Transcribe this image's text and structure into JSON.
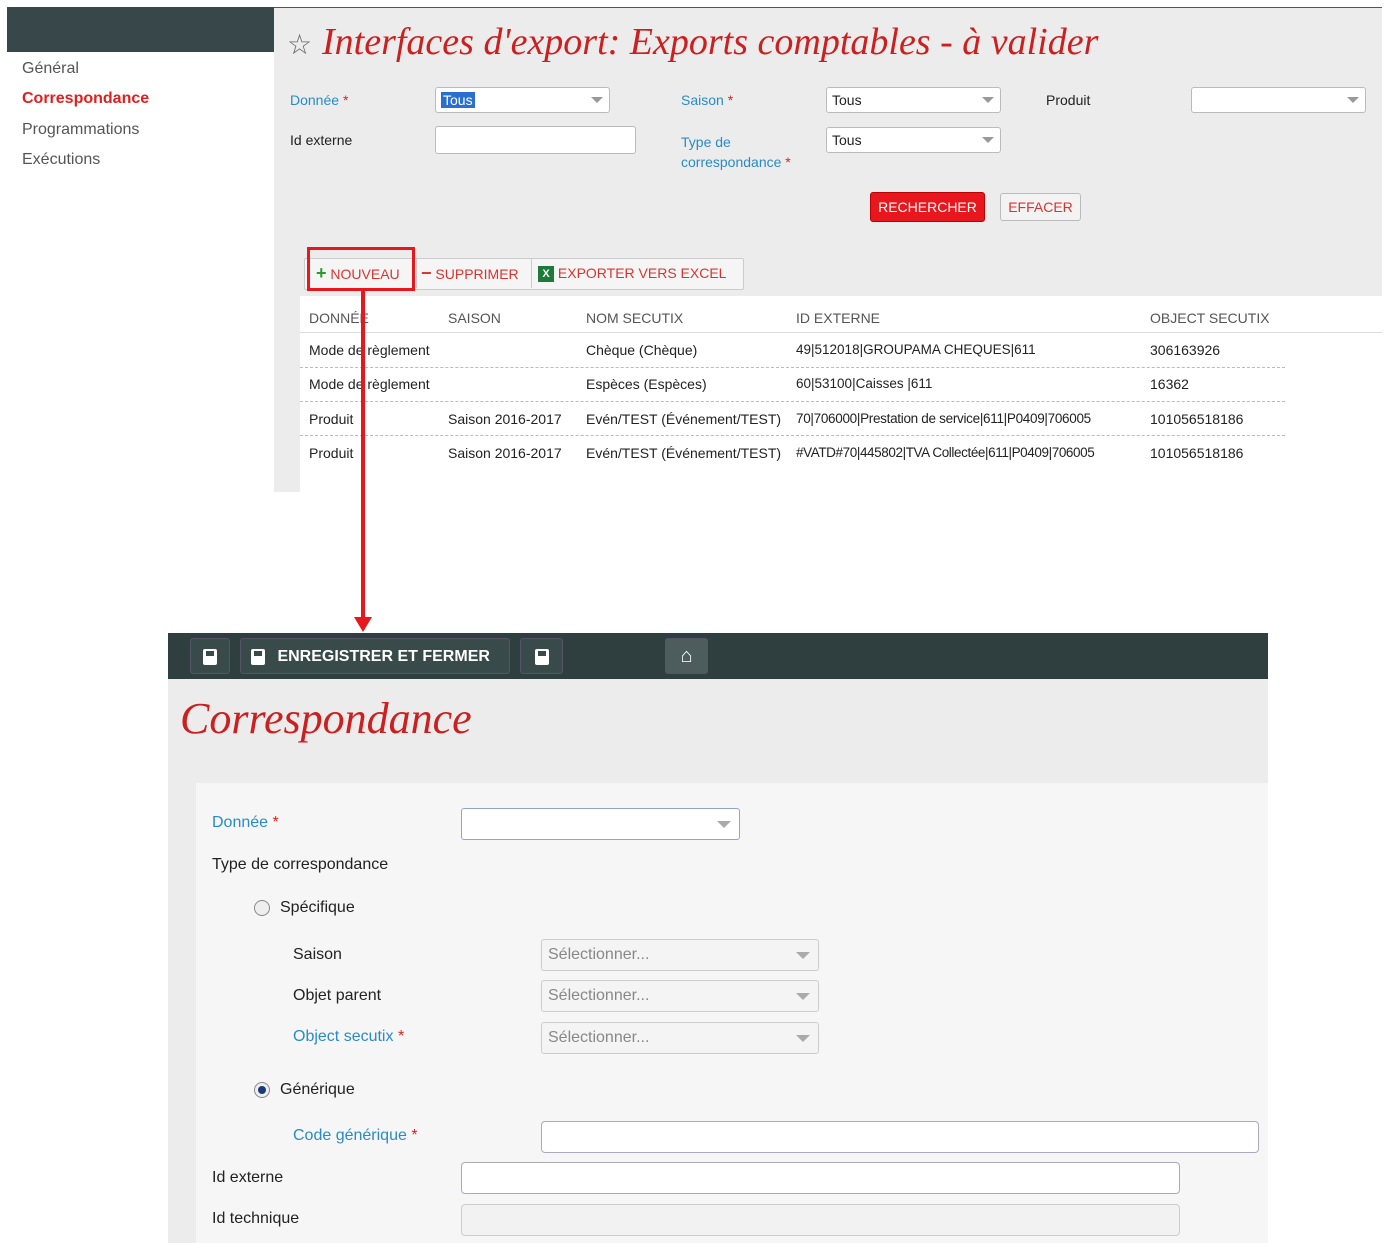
{
  "top": {
    "sidebar": [
      {
        "label": "Général",
        "active": false
      },
      {
        "label": "Correspondance",
        "active": true
      },
      {
        "label": "Programmations",
        "active": false
      },
      {
        "label": "Exécutions",
        "active": false
      }
    ],
    "title": "Interfaces d'export: Exports comptables - à valider",
    "filters": {
      "donnee_label": "Donnée",
      "donnee_value": "Tous",
      "saison_label": "Saison",
      "saison_value": "Tous",
      "produit_label": "Produit",
      "produit_value": "",
      "id_externe_label": "Id externe",
      "type_label_line1": "Type de",
      "type_label_line2": "correspondance",
      "type_value": "Tous",
      "required_mark": "*"
    },
    "buttons": {
      "search": "RECHERCHER",
      "clear": "EFFACER"
    },
    "toolbar": {
      "new": "NOUVEAU",
      "delete": "SUPPRIMER",
      "export": "EXPORTER VERS EXCEL"
    },
    "table": {
      "columns": [
        "DONNÉE",
        "SAISON",
        "NOM SECUTIX",
        "ID EXTERNE",
        "OBJECT SECUTIX"
      ],
      "rows": [
        [
          "Mode de règlement",
          "",
          "Chèque (Chèque)",
          "49|512018|GROUPAMA CHEQUES|611",
          "306163926"
        ],
        [
          "Mode de règlement",
          "",
          "Espèces (Espèces)",
          "60|53100|Caisses |611",
          "16362"
        ],
        [
          "Produit",
          "Saison 2016-2017",
          "Evén/TEST (Événement/TEST)",
          "70|706000|Prestation de service|611|P0409|706005",
          "101056518186"
        ],
        [
          "Produit",
          "Saison 2016-2017",
          "Evén/TEST (Événement/TEST)",
          "#VATD#70|445802|TVA Collectée|611|P0409|706005",
          "101056518186"
        ]
      ]
    }
  },
  "dialog": {
    "toolbar": {
      "save_close": "ENREGISTRER ET FERMER"
    },
    "title": "Correspondance",
    "form": {
      "donnee_label": "Donnée",
      "donnee_value": "",
      "type_label": "Type de correspondance",
      "specifique_label": "Spécifique",
      "specifique_checked": false,
      "saison_label": "Saison",
      "saison_placeholder": "Sélectionner...",
      "objet_parent_label": "Objet parent",
      "objet_parent_placeholder": "Sélectionner...",
      "object_secutix_label": "Object secutix",
      "object_secutix_placeholder": "Sélectionner...",
      "generique_label": "Générique",
      "generique_checked": true,
      "code_generique_label": "Code générique",
      "id_externe_label": "Id externe",
      "id_technique_label": "Id technique",
      "required_mark": "*"
    }
  },
  "colors": {
    "accent_red": "#cc1f1f",
    "link_blue": "#2a8bc7",
    "toolbar_dark": "#2f3f3f"
  }
}
